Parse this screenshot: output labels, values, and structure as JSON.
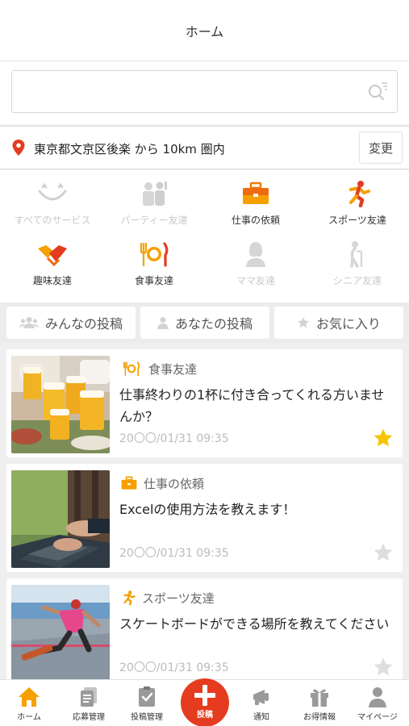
{
  "header": {
    "title": "ホーム"
  },
  "search": {
    "value": "",
    "placeholder": ""
  },
  "location": {
    "text": "東京都文京区後楽 から 10km 圏内",
    "change_label": "変更"
  },
  "categories": [
    {
      "label": "すべてのサービス",
      "icon": "smile-icon",
      "active": false
    },
    {
      "label": "パーティー友達",
      "icon": "party-people-icon",
      "active": false
    },
    {
      "label": "仕事の依頼",
      "icon": "briefcase-icon",
      "active": true
    },
    {
      "label": "スポーツ友達",
      "icon": "runner-icon",
      "active": true
    },
    {
      "label": "趣味友達",
      "icon": "handshake-icon",
      "active": true
    },
    {
      "label": "食事友達",
      "icon": "fork-plate-knife-icon",
      "active": true
    },
    {
      "label": "ママ友達",
      "icon": "mom-icon",
      "active": false
    },
    {
      "label": "シニア友達",
      "icon": "senior-cane-icon",
      "active": false
    }
  ],
  "filters": [
    {
      "label": "みんなの投稿",
      "icon": "users-icon"
    },
    {
      "label": "あなたの投稿",
      "icon": "user-icon"
    },
    {
      "label": "お気に入り",
      "icon": "star-icon"
    }
  ],
  "posts": [
    {
      "category": "食事友達",
      "category_icon": "fork-plate-knife-icon",
      "title": "仕事終わりの1杯に付き合ってくれる方いませんか？",
      "date": "20〇〇/01/31 09:35",
      "favorited": true,
      "image": "beer-toast-photo"
    },
    {
      "category": "仕事の依頼",
      "category_icon": "briefcase-icon",
      "title": "Excelの使用方法を教えます！",
      "date": "20〇〇/01/31 09:35",
      "favorited": false,
      "image": "laptop-typing-photo"
    },
    {
      "category": "スポーツ友達",
      "category_icon": "runner-icon",
      "title": "スケートボードができる場所を教えてください",
      "date": "20〇〇/01/31 09:35",
      "favorited": false,
      "image": "skateboarder-photo"
    }
  ],
  "nav": {
    "home": "ホーム",
    "applications": "応募管理",
    "posts_manage": "投稿管理",
    "post": "投稿",
    "notifications": "通知",
    "deals": "お得情報",
    "mypage": "マイページ"
  },
  "colors": {
    "accent": "#e53c1f",
    "orange": "#f5a000",
    "star_active": "#f7c600",
    "inactive": "#c9c9c9"
  }
}
